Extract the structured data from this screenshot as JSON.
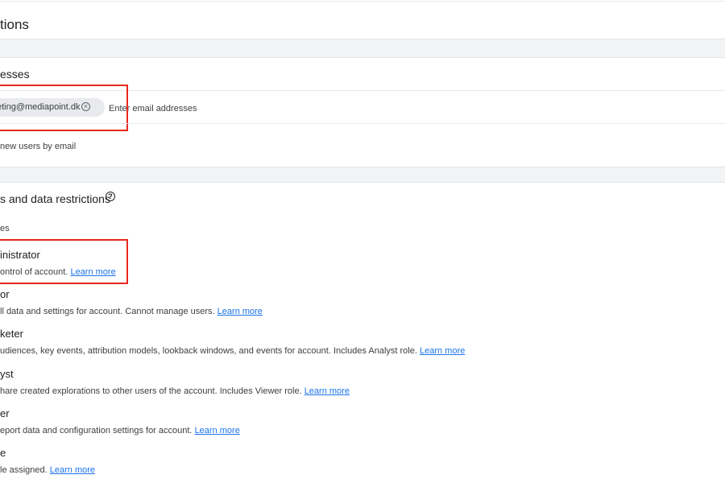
{
  "header": {
    "title": "tions"
  },
  "email_section": {
    "title": "esses",
    "chip_email": "eting@mediapoint.dk",
    "input_placeholder": "Enter email addresses",
    "notify_label": "new users by email"
  },
  "roles_section": {
    "title": "s and data restrictions",
    "subheading": "es",
    "link_text": "Learn more",
    "roles": [
      {
        "name": "inistrator",
        "desc": "ontrol of account."
      },
      {
        "name": "or",
        "desc": "ll data and settings for account. Cannot manage users."
      },
      {
        "name": "keter",
        "desc": "udiences, key events, attribution models, lookback windows, and events for account. Includes Analyst role."
      },
      {
        "name": "yst",
        "desc": "hare created explorations to other users of the account. Includes Viewer role."
      },
      {
        "name": "er",
        "desc": "eport data and configuration settings for account."
      },
      {
        "name": "e",
        "desc": "le assigned."
      }
    ]
  },
  "colors": {
    "annotation": "#e8281e",
    "link": "#1a73e8",
    "band": "#f1f3f4"
  },
  "icons": {
    "chip_remove": "close-circle-icon",
    "help": "help-circle-icon"
  }
}
